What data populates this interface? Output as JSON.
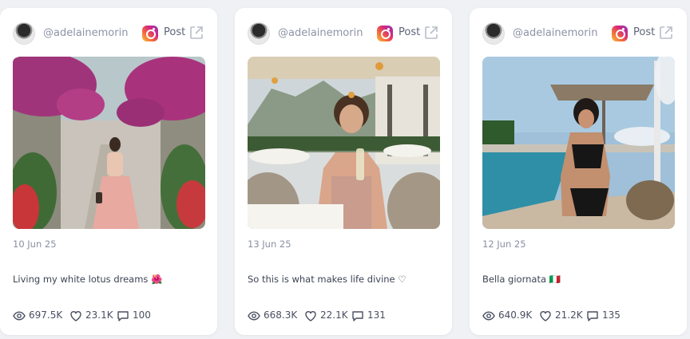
{
  "cards": [
    {
      "handle": "@adelainemorin",
      "post_label": "Post",
      "date": "10 Jun 25",
      "caption": "Living my white lotus dreams 🌺",
      "views": "697.5K",
      "likes": "23.1K",
      "comments": "100"
    },
    {
      "handle": "@adelainemorin",
      "post_label": "Post",
      "date": "13 Jun 25",
      "caption": "So this is what makes life divine ♡",
      "views": "668.3K",
      "likes": "22.1K",
      "comments": "131"
    },
    {
      "handle": "@adelainemorin",
      "post_label": "Post",
      "date": "12 Jun 25",
      "caption": "Bella giornata 🇮🇹",
      "views": "640.9K",
      "likes": "21.2K",
      "comments": "135"
    }
  ],
  "icons": {
    "platform": "instagram-icon",
    "external": "external-link-icon",
    "views": "eye-icon",
    "likes": "heart-icon",
    "comments": "comment-icon"
  },
  "colors": {
    "background": "#f0f1f5",
    "card": "#ffffff",
    "muted_text": "#8d93a6"
  }
}
